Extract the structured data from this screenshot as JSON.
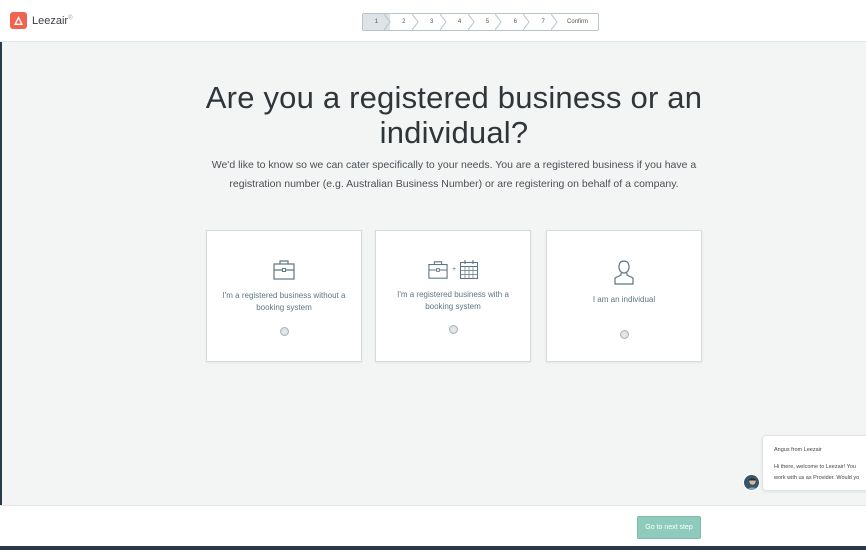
{
  "header": {
    "logo_text": "Leezair",
    "logo_mark_icon": "leezair-logo-icon",
    "steps": [
      "1",
      "2",
      "3",
      "4",
      "5",
      "6",
      "7",
      "Confirm"
    ],
    "active_step": "1"
  },
  "main": {
    "title": "Are you a registered business or an individual?",
    "subtitle": "We'd like to know so we can cater specifically to your needs. You are a registered business if you have a registration number (e.g. Australian Business Number) or are registering on behalf of a company.",
    "options": [
      {
        "label": "I'm a registered business without a booking system",
        "icons": [
          "briefcase-icon"
        ]
      },
      {
        "label": "I'm a registered business with a booking system",
        "icons": [
          "briefcase-icon",
          "calendar-icon"
        ]
      },
      {
        "label": "I am an individual",
        "icons": [
          "person-icon"
        ]
      }
    ],
    "plus_symbol": "+"
  },
  "footer": {
    "next_button": "Go to next step"
  },
  "chat": {
    "from": "Angus from Leezair",
    "message_line1": "Hi there, welcome to Leezair! You",
    "message_line2": "work with us as Provider. Would yo"
  },
  "colors": {
    "brand": "#f0644f",
    "button": "#8ecbbd",
    "accent_text": "#5f7685"
  }
}
